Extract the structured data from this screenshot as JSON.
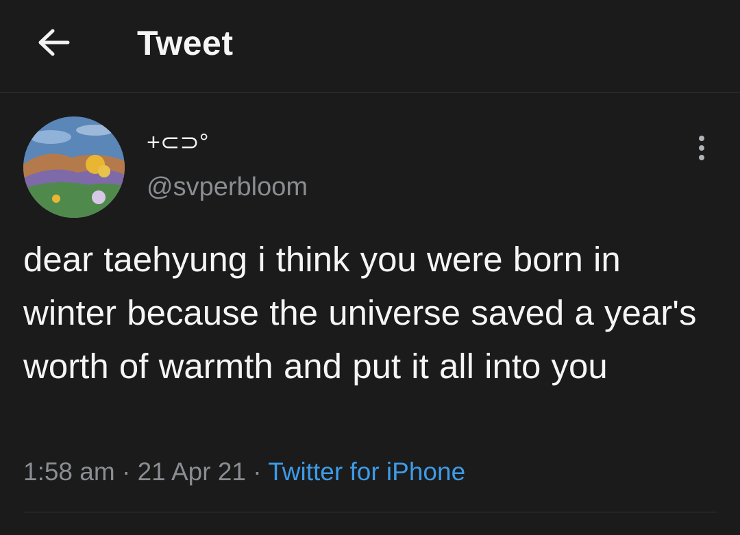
{
  "header": {
    "back_icon": "arrow-left-icon",
    "title": "Tweet"
  },
  "tweet": {
    "display_name": "+⊂⊃°",
    "handle": "@svperbloom",
    "text": "dear taehyung i think you were born in winter because the universe saved a year's worth of warmth and put it all into you",
    "time": "1:58 am",
    "separator": "·",
    "date": "21 Apr 21",
    "source": "Twitter for iPhone",
    "more_icon": "more-vertical-icon"
  },
  "colors": {
    "background": "#1b1b1b",
    "text": "#f5f5f5",
    "muted": "#8a8d91",
    "link": "#3d9be9",
    "divider": "#343434"
  }
}
